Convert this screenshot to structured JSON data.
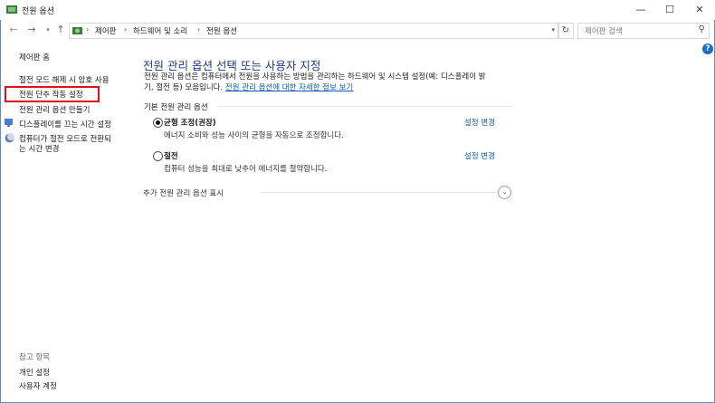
{
  "window": {
    "title": "전원 옵션",
    "minimize": "—",
    "maximize": "☐",
    "close": "✕"
  },
  "nav": {
    "back": "←",
    "forward": "→",
    "dropdown": "▾",
    "up": "↑",
    "breadcrumb": [
      "제어판",
      "하드웨어 및 소리",
      "전원 옵션"
    ],
    "separator": "›",
    "refresh": "↻",
    "search_placeholder": "제어판 검색",
    "search_icon": "⚲"
  },
  "help": "?",
  "sidebar": {
    "home": "제어판 홈",
    "items": [
      "절전 모드 해제 시 암호 사용",
      "전원 단추 작동 설정",
      "전원 관리 옵션 만들기",
      "디스플레이를 끄는 시간 설정",
      "컴퓨터가 절전 모드로 전환되",
      "는 시간 변경"
    ],
    "see_also": "참고 항목",
    "see_also_items": [
      "개인 설정",
      "사용자 계정"
    ]
  },
  "main": {
    "title": "전원 관리 옵션 선택 또는 사용자 지정",
    "desc_line1": "전원 관리 옵션은 컴퓨터에서 전원을 사용하는 방법을 관리하는 하드웨어 및 시스템 설정(예: 디스플레이 밝",
    "desc_line2": "기, 절전 등) 모음입니다. ",
    "desc_link": "전원 관리 옵션에 대한 자세한 정보 보기",
    "section": "기본 전원 관리 옵션",
    "plans": [
      {
        "name": "균형 조정(권장)",
        "desc": "에너지 소비와 성능 사이의 균형을 자동으로 조정합니다.",
        "link": "설정 변경",
        "selected": true
      },
      {
        "name": "절전",
        "desc": "컴퓨터 성능을 최대로 낮추어 에너지를 절약합니다.",
        "link": "설정 변경",
        "selected": false
      }
    ],
    "expander": "추가 전원 관리 옵션 표시",
    "expander_icon": "⌄"
  }
}
